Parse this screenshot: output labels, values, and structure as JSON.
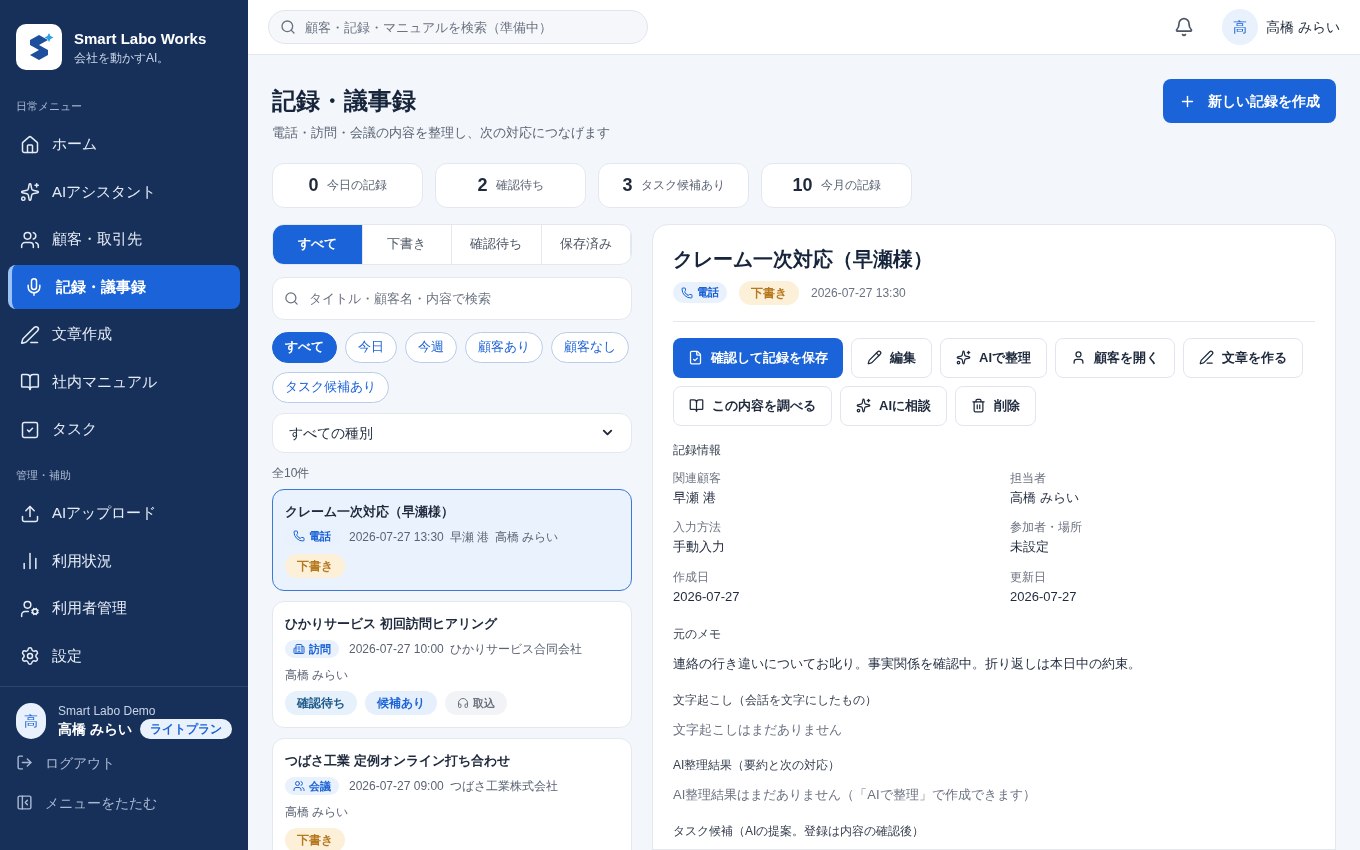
{
  "brand": {
    "name": "Smart Labo Works",
    "tagline": "会社を動かすAI。"
  },
  "sidebar": {
    "sections": [
      {
        "heading": "日常メニュー",
        "items": [
          {
            "label": "ホーム",
            "selected": false
          },
          {
            "label": "AIアシスタント",
            "selected": false
          },
          {
            "label": "顧客・取引先",
            "selected": false
          },
          {
            "label": "記録・議事録",
            "selected": true
          },
          {
            "label": "文章作成",
            "selected": false
          },
          {
            "label": "社内マニュアル",
            "selected": false
          },
          {
            "label": "タスク",
            "selected": false
          }
        ]
      },
      {
        "heading": "管理・補助",
        "items": [
          {
            "label": "AIアップロード",
            "selected": false
          },
          {
            "label": "利用状況",
            "selected": false
          },
          {
            "label": "利用者管理",
            "selected": false
          },
          {
            "label": "設定",
            "selected": false
          }
        ]
      }
    ],
    "account": {
      "org": "Smart Labo Demo",
      "avatar": "高",
      "name": "高橋 みらい",
      "plan": "ライトプラン"
    },
    "footer": [
      "ログアウト",
      "メニューをたたむ"
    ]
  },
  "topbar": {
    "search_placeholder": "顧客・記録・マニュアルを検索（準備中）",
    "user": {
      "avatar": "高",
      "name": "高橋 みらい"
    }
  },
  "page": {
    "title": "記録・議事録",
    "subtitle": "電話・訪問・会議の内容を整理し、次の対応につなげます",
    "new_button": "新しい記録を作成"
  },
  "stats": [
    {
      "value": "0",
      "label": "今日の記録"
    },
    {
      "value": "2",
      "label": "確認待ち"
    },
    {
      "value": "3",
      "label": "タスク候補あり"
    },
    {
      "value": "10",
      "label": "今月の記録"
    }
  ],
  "tabs": [
    {
      "label": "すべて",
      "selected": true
    },
    {
      "label": "下書き",
      "selected": false
    },
    {
      "label": "確認待ち",
      "selected": false
    },
    {
      "label": "保存済み",
      "selected": false
    }
  ],
  "list_search": {
    "placeholder": "タイトル・顧客名・内容で検索"
  },
  "filters": [
    {
      "label": "すべて",
      "selected": true
    },
    {
      "label": "今日",
      "selected": false
    },
    {
      "label": "今週",
      "selected": false
    },
    {
      "label": "顧客あり",
      "selected": false
    },
    {
      "label": "顧客なし",
      "selected": false
    },
    {
      "label": "タスク候補あり",
      "selected": false
    }
  ],
  "type_select": {
    "value": "すべての種別"
  },
  "count": "全10件",
  "records": [
    {
      "title": "クレーム一次対応（早瀬様）",
      "selected": true,
      "type": {
        "kind": "call",
        "label": "電話"
      },
      "meta": [
        "2026-07-27 13:30",
        "早瀬 港",
        "高橋 みらい"
      ],
      "badges": [
        {
          "kind": "draft",
          "label": "下書き"
        }
      ]
    },
    {
      "title": "ひかりサービス 初回訪問ヒアリング",
      "selected": false,
      "type": {
        "kind": "visit",
        "label": "訪問"
      },
      "meta": [
        "2026-07-27 10:00",
        "ひかりサービス合同会社",
        "高橋 みらい"
      ],
      "badges": [
        {
          "kind": "pending",
          "label": "確認待ち"
        },
        {
          "kind": "candidate",
          "label": "候補あり"
        },
        {
          "kind": "import",
          "label": "取込"
        }
      ]
    },
    {
      "title": "つばさ工業 定例オンライン打ち合わせ",
      "selected": false,
      "type": {
        "kind": "meeting",
        "label": "会議"
      },
      "meta": [
        "2026-07-27 09:00",
        "つばさ工業株式会社",
        "高橋 みらい"
      ],
      "badges": [
        {
          "kind": "draft",
          "label": "下書き"
        }
      ]
    }
  ],
  "detail": {
    "title": "クレーム一次対応（早瀬様）",
    "type": {
      "kind": "call",
      "label": "電話"
    },
    "status": {
      "kind": "draft",
      "label": "下書き"
    },
    "datetime": "2026-07-27 13:30",
    "actions": [
      {
        "label": "確認して記録を保存",
        "primary": true
      },
      {
        "label": "編集",
        "primary": false
      },
      {
        "label": "AIで整理",
        "primary": false
      },
      {
        "label": "顧客を開く",
        "primary": false
      },
      {
        "label": "文章を作る",
        "primary": false
      },
      {
        "label": "この内容を調べる",
        "primary": false
      },
      {
        "label": "AIに相談",
        "primary": false
      },
      {
        "label": "削除",
        "primary": false
      }
    ],
    "info": {
      "heading": "記録情報",
      "fields": [
        {
          "label": "関連顧客",
          "value": "早瀬 港"
        },
        {
          "label": "担当者",
          "value": "高橋 みらい"
        },
        {
          "label": "入力方法",
          "value": "手動入力"
        },
        {
          "label": "参加者・場所",
          "value": "未設定"
        },
        {
          "label": "作成日",
          "value": "2026-07-27"
        },
        {
          "label": "更新日",
          "value": "2026-07-27"
        }
      ]
    },
    "sections": [
      {
        "heading": "元のメモ",
        "body": "連絡の行き違いについてお叱り。事実関係を確認中。折り返しは本日中の約束。",
        "empty": false
      },
      {
        "heading": "文字起こし（会話を文字にしたもの）",
        "body": "文字起こしはまだありません",
        "empty": true
      },
      {
        "heading": "AI整理結果（要約と次の対応）",
        "body": "AI整理結果はまだありません（「AIで整理」で作成できます）",
        "empty": true
      },
      {
        "heading": "タスク候補（AIの提案。登録は内容の確認後）"
      }
    ]
  }
}
